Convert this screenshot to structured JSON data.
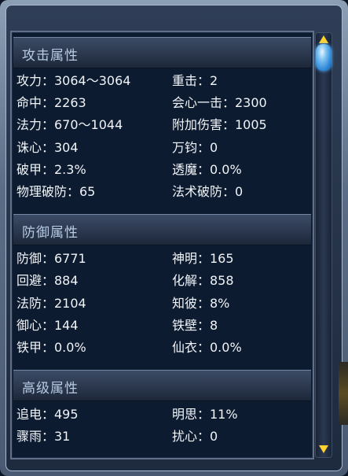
{
  "sections": [
    {
      "title": "攻击属性",
      "rows": [
        {
          "left": "攻力：3064～3064",
          "right": "重击：2"
        },
        {
          "left": "命中：2263",
          "right": "会心一击：2300"
        },
        {
          "left": "法力：670～1044",
          "right": "附加伤害：1005"
        },
        {
          "left": "诛心：304",
          "right": "万钧：0"
        },
        {
          "left": "破甲：2.3%",
          "right": "透魔：0.0%"
        },
        {
          "left": "物理破防：65",
          "right": "法术破防：0"
        }
      ]
    },
    {
      "title": "防御属性",
      "rows": [
        {
          "left": "防御：6771",
          "right": "神明：165"
        },
        {
          "left": "回避：884",
          "right": "化解：858"
        },
        {
          "left": "法防：2104",
          "right": "知彼：8%"
        },
        {
          "left": "御心：144",
          "right": "铁壁：8"
        },
        {
          "left": "铁甲：0.0%",
          "right": "仙衣：0.0%"
        }
      ]
    },
    {
      "title": "高级属性",
      "rows": [
        {
          "left": "追电：495",
          "right": "明思：11%"
        },
        {
          "left": "骤雨：31",
          "right": "扰心：0"
        }
      ]
    }
  ],
  "colors": {
    "panel_bg": "#0d1b30",
    "header_text": "#b7cbe4",
    "value_text": "#f1f4f8",
    "scroll_arrow": "#ffd22e",
    "scroll_thumb": "#2b86d6"
  },
  "icons": {
    "scroll_up": "triangle-up-icon",
    "scroll_down": "triangle-down-icon"
  }
}
